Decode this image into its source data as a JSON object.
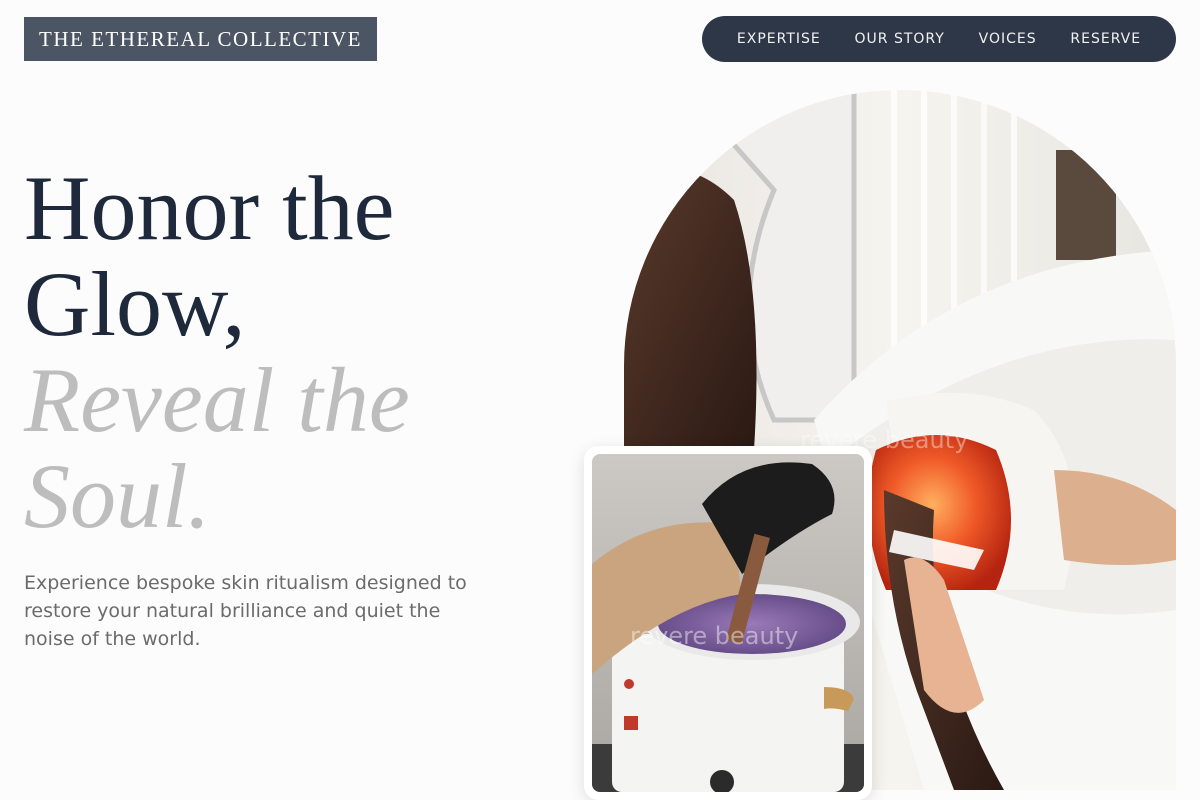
{
  "brand": {
    "logo_text": "THE ETHEREAL COLLECTIVE"
  },
  "nav": {
    "items": [
      {
        "label": "EXPERTISE"
      },
      {
        "label": "OUR STORY"
      },
      {
        "label": "VOICES"
      },
      {
        "label": "RESERVE"
      }
    ]
  },
  "hero": {
    "title_line1": "Honor the",
    "title_line2": "Glow,",
    "title_line3": "Reveal the",
    "title_line4": "Soul.",
    "description": "Experience bespoke skin ritualism designed to restore your natural brilliance and quiet the noise of the world."
  },
  "images": {
    "main_watermark": "revere beauty",
    "inset_watermark": "revere beauty"
  },
  "colors": {
    "nav_background": "#2d3748",
    "logo_background": "#4b5563",
    "headline_dark": "#1e293b",
    "headline_muted": "#bdbdbd",
    "body_text": "#6b6b6b"
  }
}
